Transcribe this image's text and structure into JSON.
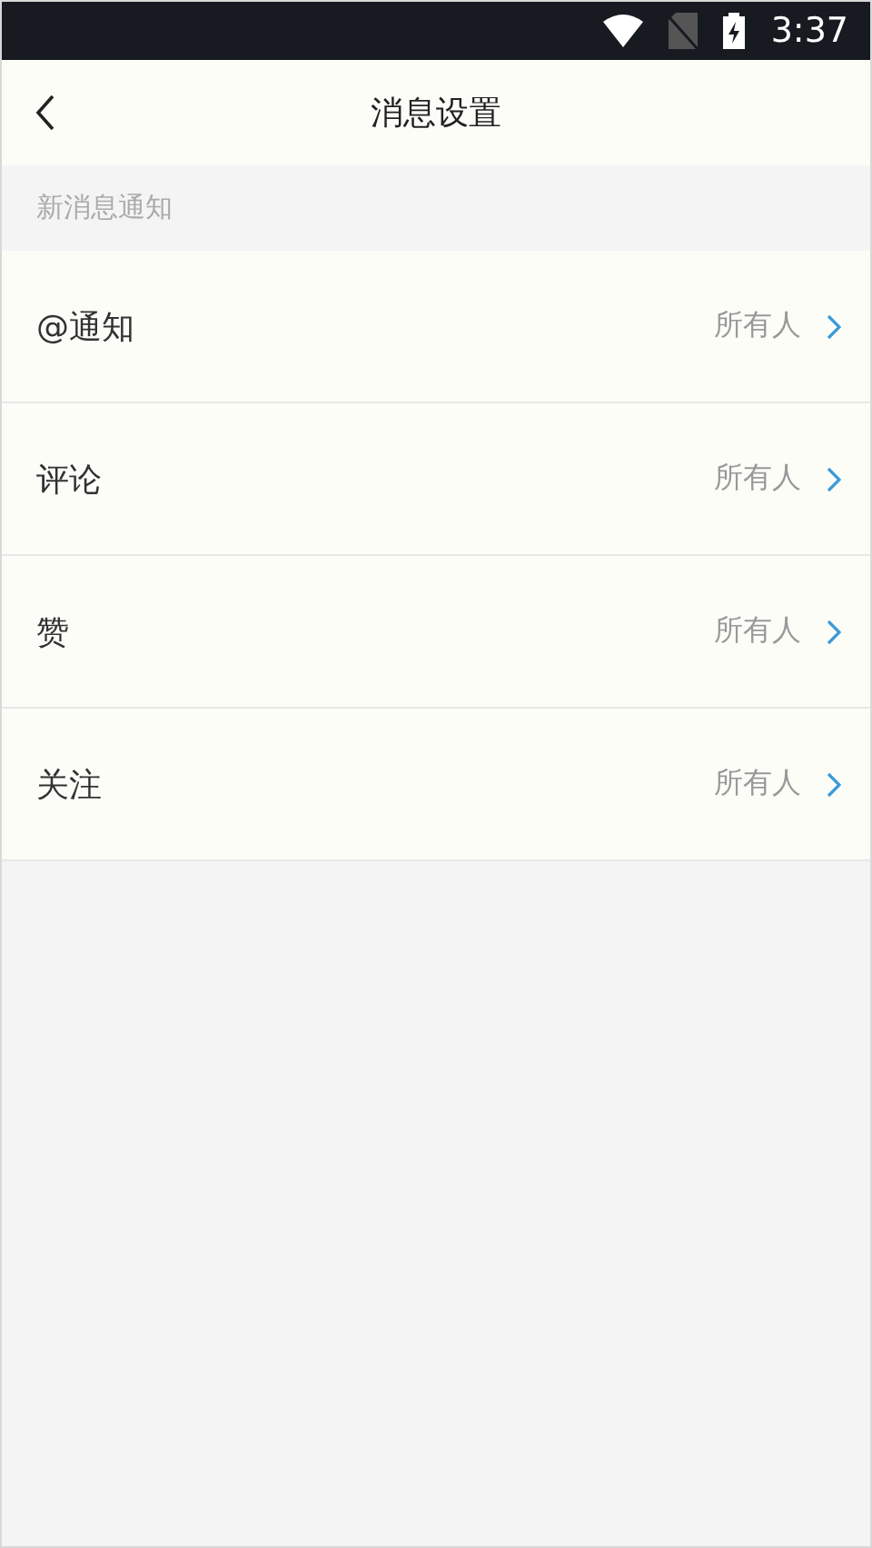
{
  "status_bar": {
    "time": "3:37"
  },
  "header": {
    "title": "消息设置"
  },
  "section": {
    "title": "新消息通知"
  },
  "rows": [
    {
      "label": "@通知",
      "value": "所有人"
    },
    {
      "label": "评论",
      "value": "所有人"
    },
    {
      "label": "赞",
      "value": "所有人"
    },
    {
      "label": "关注",
      "value": "所有人"
    }
  ]
}
